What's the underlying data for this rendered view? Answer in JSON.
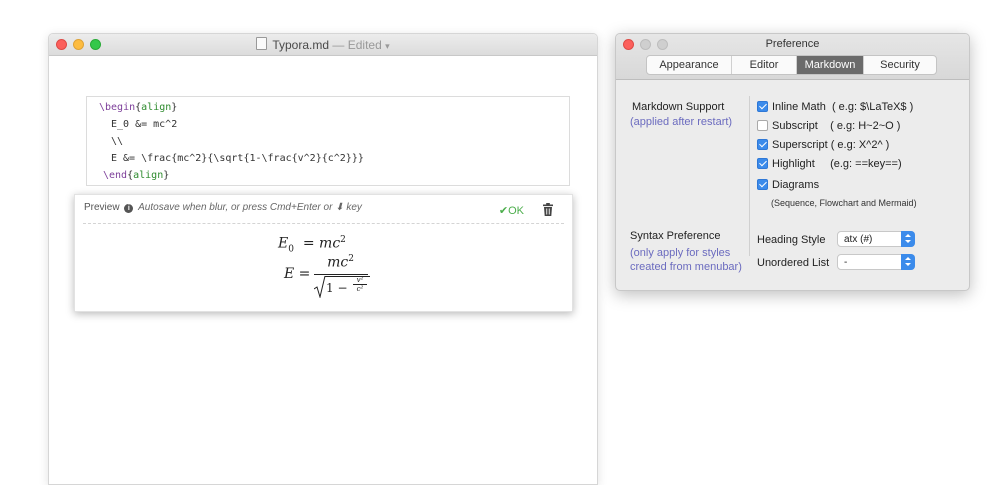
{
  "editor": {
    "title_file": "Typora.md",
    "title_status": "Edited",
    "code_lines": [
      {
        "kw": "\\begin",
        "arg": "align"
      },
      "E_0 &= mc^2",
      "\\\\",
      "E &= \\frac{mc^2}{\\sqrt{1-\\frac{v^2}{c^2}}}",
      {
        "kw": "\\end",
        "arg": "align"
      }
    ],
    "preview": {
      "label": "Preview",
      "hint": "Autosave when blur, or press Cmd+Enter or",
      "hint_key": "⬇︎ key",
      "ok_label": "OK",
      "eq1_lhs": "E",
      "eq1_sub": "0",
      "eq1_rhs": "= mc",
      "eq2_lhs": "E =",
      "eq2_num": "mc",
      "eq2_sqrt": "1 −",
      "eq2_frac_num": "v²",
      "eq2_frac_den": "c²",
      "sup2": "2"
    }
  },
  "preference": {
    "title": "Preference",
    "tabs": [
      {
        "label": "Appearance",
        "active": false
      },
      {
        "label": "Editor",
        "active": false
      },
      {
        "label": "Markdown",
        "active": true
      },
      {
        "label": "Security",
        "active": false
      }
    ],
    "markdown_support": {
      "label": "Markdown Support",
      "sub": "(applied after restart)",
      "options": [
        {
          "label": "Inline Math",
          "hint": "( e.g: $\\LaTeX$ )",
          "checked": true
        },
        {
          "label": "Subscript",
          "hint": "( e.g: H~2~O )",
          "checked": false
        },
        {
          "label": "Superscript",
          "hint": "( e.g: X^2^ )",
          "checked": true
        },
        {
          "label": "Highlight",
          "hint": "(e.g: ==key==)",
          "checked": true
        },
        {
          "label": "Diagrams",
          "hint": "",
          "checked": true
        }
      ],
      "diagrams_note": "(Sequence, Flowchart and Mermaid)"
    },
    "syntax": {
      "label": "Syntax Preference",
      "sub1": "(only apply for styles",
      "sub2": "created from menubar)",
      "heading_label": "Heading Style",
      "heading_value": "atx (#)",
      "list_label": "Unordered List",
      "list_value": "-"
    }
  },
  "colors": {
    "accent": "#3b8beb",
    "ok_green": "#4cae4c",
    "sub_purple": "#6b6bbf"
  }
}
